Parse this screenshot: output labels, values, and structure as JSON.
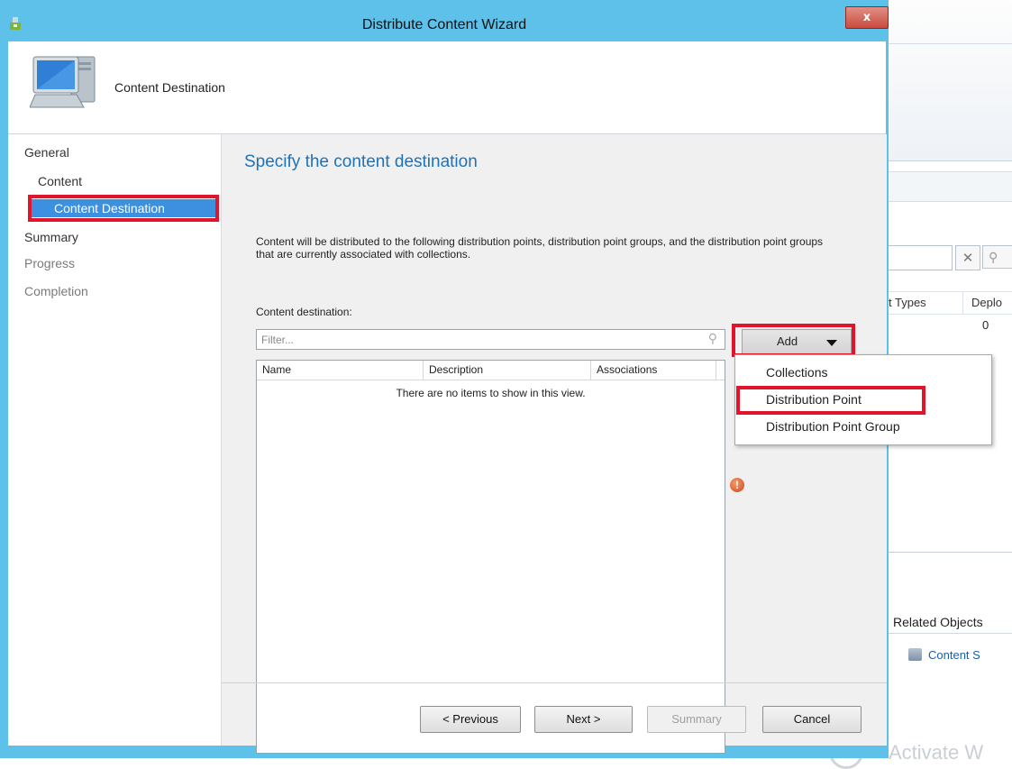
{
  "window": {
    "title": "Distribute Content Wizard",
    "close_glyph": "x",
    "header_title": "Content Destination"
  },
  "nav": {
    "items": [
      {
        "label": "General",
        "state": "normal"
      },
      {
        "label": "Content",
        "state": "normal"
      },
      {
        "label": "Content Destination",
        "state": "selected"
      },
      {
        "label": "Summary",
        "state": "normal"
      },
      {
        "label": "Progress",
        "state": "disabled"
      },
      {
        "label": "Completion",
        "state": "disabled"
      }
    ]
  },
  "main": {
    "heading": "Specify the content destination",
    "intro": "Content will be distributed to the following distribution points, distribution point groups, and the distribution point groups that are currently associated with collections.",
    "destination_label": "Content destination:",
    "filter_placeholder": "Filter...",
    "columns": [
      "Name",
      "Description",
      "Associations"
    ],
    "empty_message": "There are no items to show in this view.",
    "add_button": "Add",
    "error_glyph": "!"
  },
  "add_menu": {
    "items": [
      "Collections",
      "Distribution Point",
      "Distribution Point Group"
    ],
    "highlighted": "Distribution Point"
  },
  "footer": {
    "previous": "< Previous",
    "next": "Next >",
    "summary": "Summary",
    "cancel": "Cancel"
  },
  "background_console": {
    "col_header_1": "t Types",
    "col_header_2": "Deplo",
    "row_value": "0",
    "related_objects": "Related Objects",
    "content_link": "Content S",
    "watermark": "Activate W",
    "clear_glyph": "✕",
    "search_glyph": "⚲"
  },
  "colors": {
    "window_frame": "#5ec1ea",
    "selection": "#3d8fe0",
    "highlight_box": "#e2142b",
    "heading": "#1e72b8"
  }
}
